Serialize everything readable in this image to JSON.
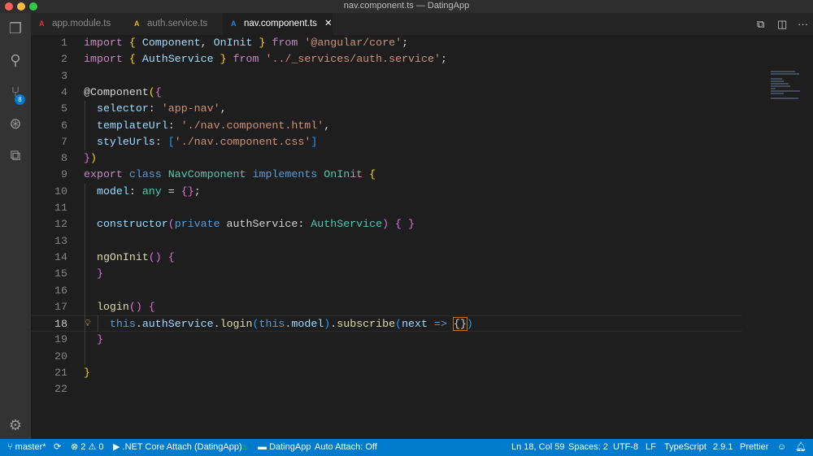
{
  "window": {
    "title": "nav.component.ts — DatingApp"
  },
  "activity_bar": [
    {
      "icon": "files-icon",
      "glyph": "❐"
    },
    {
      "icon": "search-icon",
      "glyph": "⚲"
    },
    {
      "icon": "source-control-icon",
      "glyph": "⑂",
      "badge": "8"
    },
    {
      "icon": "debug-icon",
      "glyph": "⊛"
    },
    {
      "icon": "extensions-icon",
      "glyph": "⧉"
    }
  ],
  "settings_glyph": "⚙",
  "tabs": [
    {
      "label": "app.module.ts",
      "icon_color": "#e23237",
      "active": false
    },
    {
      "label": "auth.service.ts",
      "icon_color": "#e7b416",
      "active": false
    },
    {
      "label": "nav.component.ts",
      "icon_color": "#1e88e5",
      "active": true,
      "close": "✕"
    }
  ],
  "current_line": 18,
  "code": [
    [
      [
        "kw",
        "import"
      ],
      [
        "pl",
        " "
      ],
      [
        "b1",
        "{"
      ],
      [
        "id",
        " Component"
      ],
      [
        "pl",
        ", "
      ],
      [
        "id",
        "OnInit"
      ],
      [
        "pl",
        " "
      ],
      [
        "b1",
        "}"
      ],
      [
        "kw",
        " from"
      ],
      [
        "str",
        " '@angular/core'"
      ],
      [
        "pl",
        ";"
      ]
    ],
    [
      [
        "kw",
        "import"
      ],
      [
        "pl",
        " "
      ],
      [
        "b1",
        "{"
      ],
      [
        "id",
        " AuthService"
      ],
      [
        "pl",
        " "
      ],
      [
        "b1",
        "}"
      ],
      [
        "kw",
        " from"
      ],
      [
        "str",
        " '../_services/auth.service'"
      ],
      [
        "pl",
        ";"
      ]
    ],
    [],
    [
      [
        "pl",
        "@Component"
      ],
      [
        "b1",
        "("
      ],
      [
        "b2",
        "{"
      ]
    ],
    [
      [
        "id",
        "  selector"
      ],
      [
        "pl",
        ": "
      ],
      [
        "str",
        "'app-nav'"
      ],
      [
        "pl",
        ","
      ]
    ],
    [
      [
        "id",
        "  templateUrl"
      ],
      [
        "pl",
        ": "
      ],
      [
        "str",
        "'./nav.component.html'"
      ],
      [
        "pl",
        ","
      ]
    ],
    [
      [
        "id",
        "  styleUrls"
      ],
      [
        "pl",
        ": "
      ],
      [
        "b3",
        "["
      ],
      [
        "str",
        "'./nav.component.css'"
      ],
      [
        "b3",
        "]"
      ]
    ],
    [
      [
        "b2",
        "}"
      ],
      [
        "b1",
        ")"
      ]
    ],
    [
      [
        "kw",
        "export"
      ],
      [
        "st",
        " class"
      ],
      [
        "ty",
        " NavComponent"
      ],
      [
        "st",
        " implements"
      ],
      [
        "ty",
        " OnInit"
      ],
      [
        "pl",
        " "
      ],
      [
        "b1",
        "{"
      ]
    ],
    [
      [
        "id",
        "  model"
      ],
      [
        "pl",
        ": "
      ],
      [
        "ty",
        "any"
      ],
      [
        "pl",
        " = "
      ],
      [
        "b2",
        "{}"
      ],
      [
        "pl",
        ";"
      ]
    ],
    [],
    [
      [
        "id",
        "  constructor"
      ],
      [
        "b2",
        "("
      ],
      [
        "st",
        "private"
      ],
      [
        "pl",
        " authService: "
      ],
      [
        "ty",
        "AuthService"
      ],
      [
        "b2",
        ")"
      ],
      [
        "pl",
        " "
      ],
      [
        "b2",
        "{ }"
      ]
    ],
    [],
    [
      [
        "fn",
        "  ngOnInit"
      ],
      [
        "b2",
        "()"
      ],
      [
        "pl",
        " "
      ],
      [
        "b2",
        "{"
      ]
    ],
    [
      [
        "pl",
        "  "
      ],
      [
        "b2",
        "}"
      ]
    ],
    [],
    [
      [
        "fn",
        "  login"
      ],
      [
        "b2",
        "()"
      ],
      [
        "pl",
        " "
      ],
      [
        "b2",
        "{"
      ]
    ],
    [
      [
        "st",
        "    this"
      ],
      [
        "pl",
        "."
      ],
      [
        "id",
        "authService"
      ],
      [
        "pl",
        "."
      ],
      [
        "fn",
        "login"
      ],
      [
        "b3",
        "("
      ],
      [
        "st",
        "this"
      ],
      [
        "pl",
        "."
      ],
      [
        "id",
        "model"
      ],
      [
        "b3",
        ")"
      ],
      [
        "pl",
        "."
      ],
      [
        "fn",
        "subscribe"
      ],
      [
        "b3",
        "("
      ],
      [
        "id",
        "next"
      ],
      [
        "st",
        " =>"
      ],
      [
        "pl",
        " "
      ],
      [
        "bm",
        "{}"
      ],
      [
        "b3",
        ")"
      ]
    ],
    [
      [
        "pl",
        "  "
      ],
      [
        "b2",
        "}"
      ]
    ],
    [],
    [
      [
        "b1",
        "}"
      ]
    ],
    []
  ],
  "status": {
    "branch": "master*",
    "sync": "⟳",
    "errors": "2",
    "warnings": "0",
    "debug": ".NET Core Attach (DatingApp)",
    "folder": "DatingApp",
    "auto_attach": "Auto Attach: Off",
    "position": "Ln 18, Col 59",
    "spaces": "Spaces: 2",
    "encoding": "UTF-8",
    "eol": "LF",
    "language": "TypeScript",
    "version": "2.9.1",
    "formatter": "Prettier"
  }
}
